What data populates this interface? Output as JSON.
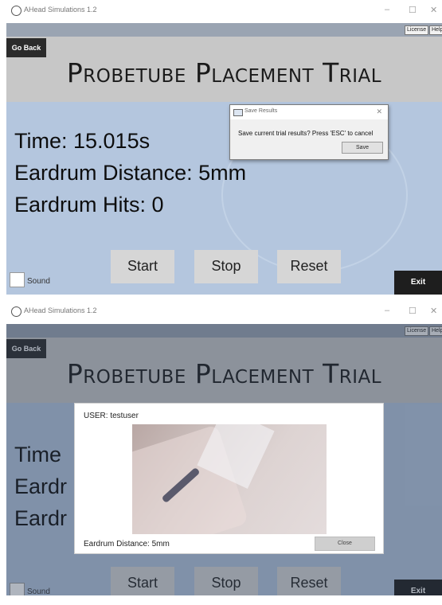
{
  "window": {
    "title": "AHead Simulations 1.2",
    "controls": {
      "minimize": "–",
      "maximize": "☐",
      "close": "✕"
    }
  },
  "menu": {
    "license_label": "License",
    "help_label": "Help"
  },
  "header": {
    "go_back_label": "Go Back",
    "title": "Probetube Placement Trial"
  },
  "stats": {
    "time": "Time: 15.015s",
    "distance": "Eardrum Distance: 5mm",
    "hits": "Eardrum Hits: 0"
  },
  "stats_partial": {
    "time": "Time",
    "distance": "Eardr",
    "hits": "Eardr"
  },
  "controls": {
    "start_label": "Start",
    "stop_label": "Stop",
    "reset_label": "Reset",
    "exit_label": "Exit"
  },
  "sound": {
    "label": "Sound",
    "checked": false
  },
  "save_dialog": {
    "title": "Save Results",
    "message": "Save current trial results? Press 'ESC' to cancel",
    "save_label": "Save",
    "close_glyph": "✕"
  },
  "result_modal": {
    "user_label": "USER: testuser",
    "distance_label": "Eardrum Distance: 5mm",
    "close_label": "Close"
  },
  "colors": {
    "main_bg": "#b4c6de",
    "header_bg": "#c7c7c7",
    "dark_button": "#2b2b2b",
    "control_button": "#d6d6d6"
  }
}
